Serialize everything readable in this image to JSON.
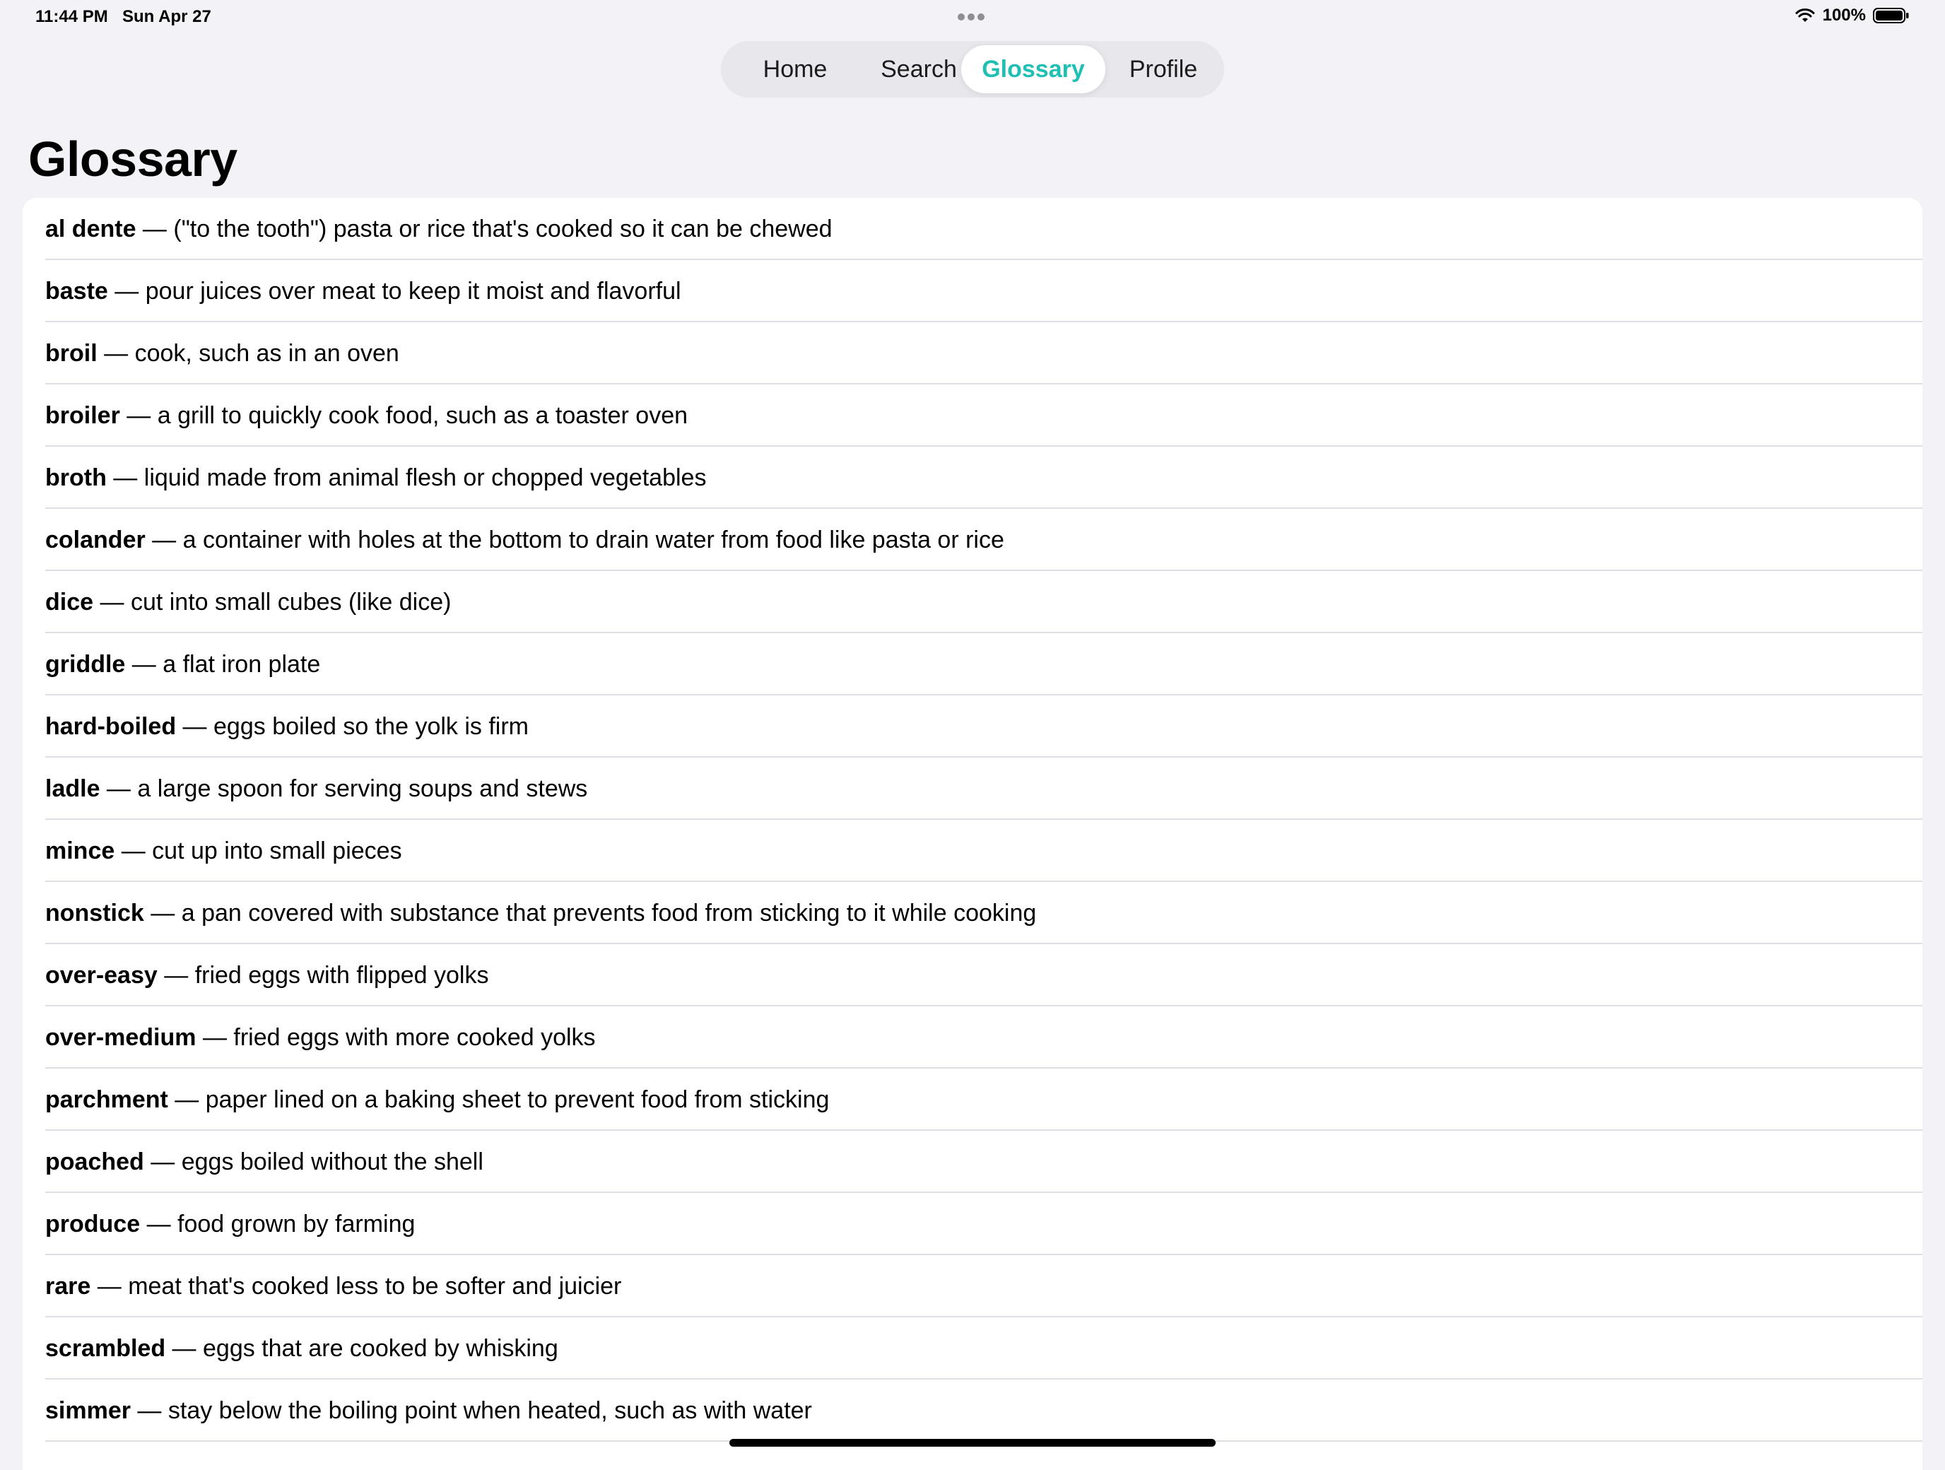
{
  "status_bar": {
    "time": "11:44 PM",
    "date": "Sun Apr 27",
    "battery": "100%"
  },
  "tabs": [
    {
      "label": "Home",
      "selected": false
    },
    {
      "label": "Search",
      "selected": false
    },
    {
      "label": "Glossary",
      "selected": true
    },
    {
      "label": "Profile",
      "selected": false
    }
  ],
  "accent_color": "#1fc0b3",
  "page_title": "Glossary",
  "separator": " — ",
  "glossary": [
    {
      "term": "al dente",
      "definition": "(\"to the tooth\") pasta or rice that's cooked so it can be chewed"
    },
    {
      "term": "baste",
      "definition": "pour juices over meat to keep it moist and flavorful"
    },
    {
      "term": "broil",
      "definition": "cook, such as in an oven"
    },
    {
      "term": "broiler",
      "definition": "a grill to quickly cook food, such as a toaster oven"
    },
    {
      "term": "broth",
      "definition": "liquid made from animal flesh or chopped vegetables"
    },
    {
      "term": "colander",
      "definition": "a container with holes at the bottom to drain water from food like pasta or rice"
    },
    {
      "term": "dice",
      "definition": "cut into small cubes (like dice)"
    },
    {
      "term": "griddle",
      "definition": "a flat iron plate"
    },
    {
      "term": "hard-boiled",
      "definition": "eggs boiled so the yolk is firm"
    },
    {
      "term": "ladle",
      "definition": "a large spoon for serving soups and stews"
    },
    {
      "term": "mince",
      "definition": "cut up into small pieces"
    },
    {
      "term": "nonstick",
      "definition": "a pan covered with substance that prevents food from sticking to it while cooking"
    },
    {
      "term": "over-easy",
      "definition": "fried eggs with flipped yolks"
    },
    {
      "term": "over-medium",
      "definition": "fried eggs with more cooked yolks"
    },
    {
      "term": "parchment",
      "definition": "paper lined on a baking sheet to prevent food from sticking"
    },
    {
      "term": "poached",
      "definition": "eggs boiled without the shell"
    },
    {
      "term": "produce",
      "definition": "food grown by farming"
    },
    {
      "term": "rare",
      "definition": "meat that's cooked less to be softer and juicier"
    },
    {
      "term": "scrambled",
      "definition": "eggs that are cooked by whisking"
    },
    {
      "term": "simmer",
      "definition": "stay below the boiling point when heated, such as with water"
    }
  ]
}
